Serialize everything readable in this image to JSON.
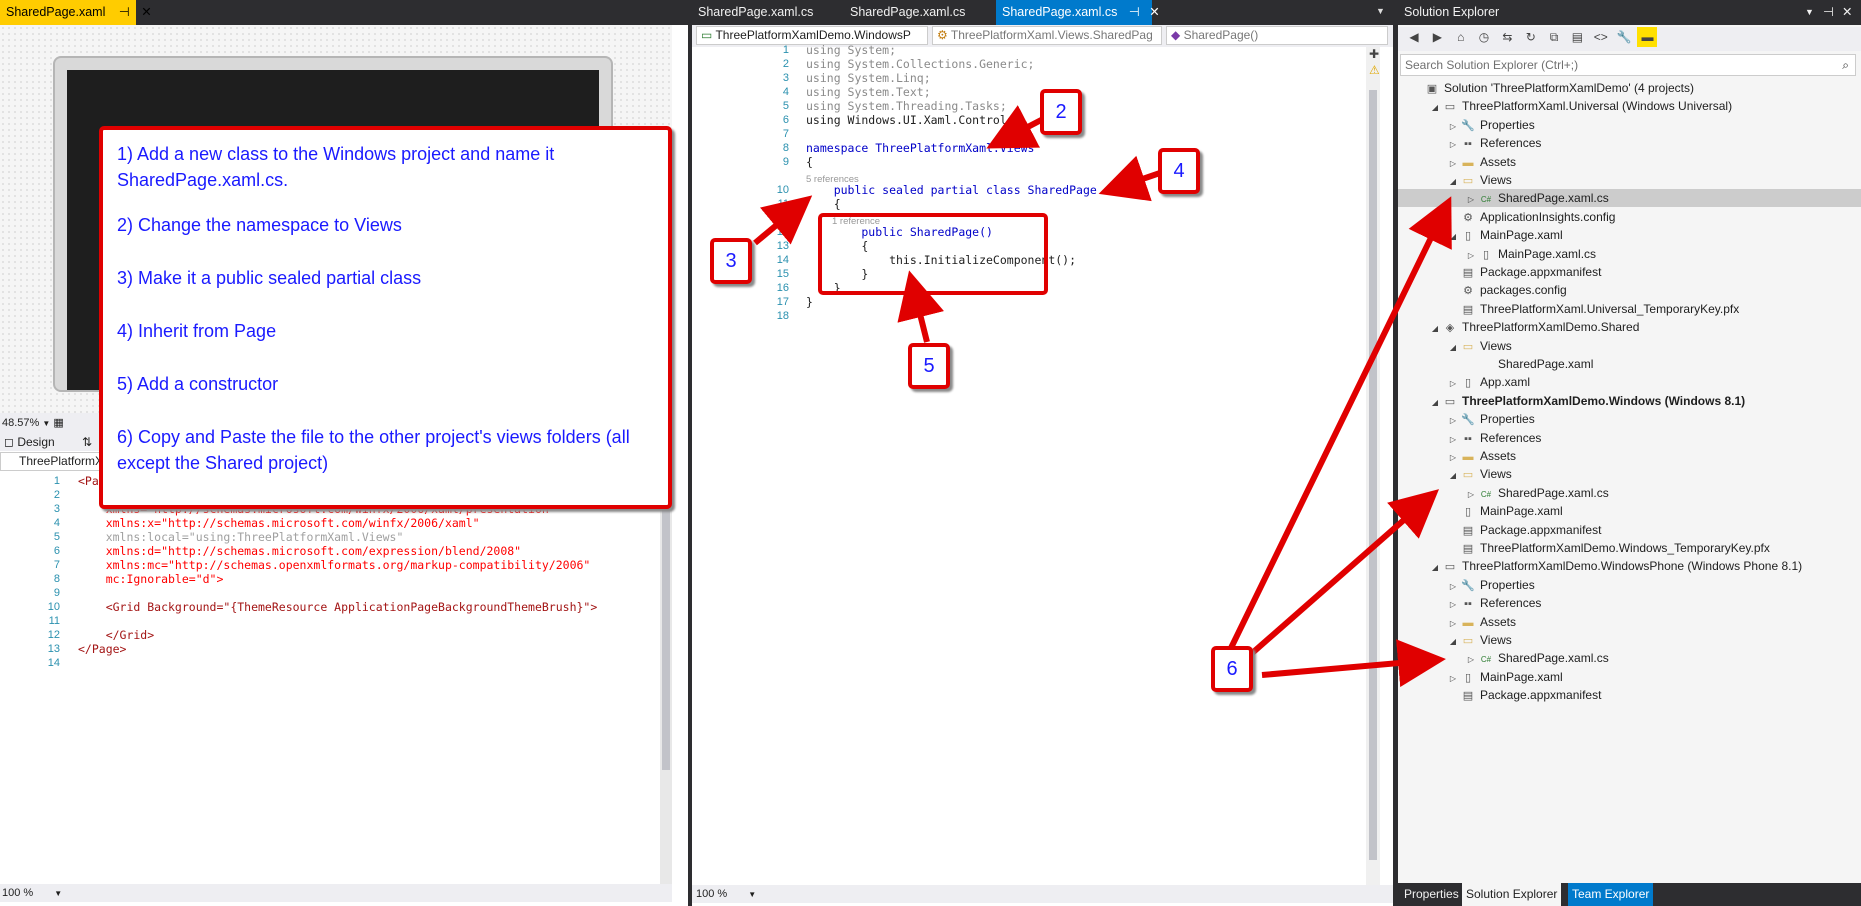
{
  "left": {
    "tab_title": "SharedPage.xaml",
    "zoom": "48.57%",
    "design_tab": "Design",
    "dropdown": "ThreePlatformX",
    "bottom_zoom": "100 %",
    "code": [
      {
        "n": "1",
        "t": "<Page"
      },
      {
        "n": "2",
        "t": ""
      },
      {
        "n": "3",
        "t": "    xmlns=\"http://schemas.microsoft.com/winfx/2006/xaml/presentation\""
      },
      {
        "n": "4",
        "t": "    xmlns:x=\"http://schemas.microsoft.com/winfx/2006/xaml\""
      },
      {
        "n": "5",
        "t": "    xmlns:local=\"using:ThreePlatformXaml.Views\""
      },
      {
        "n": "6",
        "t": "    xmlns:d=\"http://schemas.microsoft.com/expression/blend/2008\""
      },
      {
        "n": "7",
        "t": "    xmlns:mc=\"http://schemas.openxmlformats.org/markup-compatibility/2006\""
      },
      {
        "n": "8",
        "t": "    mc:Ignorable=\"d\">"
      },
      {
        "n": "9",
        "t": ""
      },
      {
        "n": "10",
        "t": "    <Grid Background=\"{ThemeResource ApplicationPageBackgroundThemeBrush}\">"
      },
      {
        "n": "11",
        "t": ""
      },
      {
        "n": "12",
        "t": "    </Grid>"
      },
      {
        "n": "13",
        "t": "</Page>"
      },
      {
        "n": "14",
        "t": ""
      }
    ]
  },
  "middle": {
    "tabs": [
      "SharedPage.xaml.cs",
      "SharedPage.xaml.cs",
      "SharedPage.xaml.cs"
    ],
    "nav_project": "ThreePlatformXamlDemo.WindowsP",
    "nav_class": "ThreePlatformXaml.Views.SharedPag",
    "nav_member": "SharedPage()",
    "bottom_zoom": "100 %",
    "code": [
      {
        "n": "1",
        "t": "using System;"
      },
      {
        "n": "2",
        "t": "using System.Collections.Generic;"
      },
      {
        "n": "3",
        "t": "using System.Linq;"
      },
      {
        "n": "4",
        "t": "using System.Text;"
      },
      {
        "n": "5",
        "t": "using System.Threading.Tasks;"
      },
      {
        "n": "6",
        "t": "using Windows.UI.Xaml.Controls;"
      },
      {
        "n": "7",
        "t": ""
      },
      {
        "n": "8",
        "t": "namespace ThreePlatformXaml.Views"
      },
      {
        "n": "9",
        "t": "{"
      },
      {
        "n": "10",
        "t": "    public sealed partial class SharedPage : Page"
      },
      {
        "n": "11",
        "t": "    {"
      },
      {
        "n": "12",
        "t": "        public SharedPage()"
      },
      {
        "n": "13",
        "t": "        {"
      },
      {
        "n": "14",
        "t": "            this.InitializeComponent();"
      },
      {
        "n": "15",
        "t": "        }"
      },
      {
        "n": "16",
        "t": "    }"
      },
      {
        "n": "17",
        "t": "}"
      },
      {
        "n": "18",
        "t": ""
      }
    ],
    "refs_class": "5 references",
    "refs_ctor": "1 reference"
  },
  "solution": {
    "title": "Solution Explorer",
    "search_placeholder": "Search Solution Explorer (Ctrl+;)",
    "items": [
      {
        "label": "Solution 'ThreePlatformXamlDemo' (4 projects)",
        "icon": "solution-icon",
        "glyph": "▣"
      },
      {
        "label": "ThreePlatformXaml.Universal (Windows Universal)",
        "icon": "project-icon",
        "glyph": "▭"
      },
      {
        "label": "Properties",
        "icon": "wrench-icon",
        "glyph": "🔧"
      },
      {
        "label": "References",
        "icon": "references-icon",
        "glyph": "▪▪"
      },
      {
        "label": "Assets",
        "icon": "folder-icon",
        "glyph": "▬"
      },
      {
        "label": "Views",
        "icon": "folder-open-icon",
        "glyph": "▭"
      },
      {
        "label": "SharedPage.xaml.cs",
        "icon": "csharp-file-icon",
        "glyph": "C#"
      },
      {
        "label": "ApplicationInsights.config",
        "icon": "config-icon",
        "glyph": "⚙"
      },
      {
        "label": "MainPage.xaml",
        "icon": "xaml-file-icon",
        "glyph": "▯"
      },
      {
        "label": "MainPage.xaml.cs",
        "icon": "cs-file-icon",
        "glyph": "▯"
      },
      {
        "label": "Package.appxmanifest",
        "icon": "manifest-icon",
        "glyph": "▤"
      },
      {
        "label": "packages.config",
        "icon": "config-icon",
        "glyph": "⚙"
      },
      {
        "label": "ThreePlatformXaml.Universal_TemporaryKey.pfx",
        "icon": "pfx-icon",
        "glyph": "▤"
      },
      {
        "label": "ThreePlatformXamlDemo.Shared",
        "icon": "shared-project-icon",
        "glyph": "◈"
      },
      {
        "label": "Views",
        "icon": "folder-open-icon",
        "glyph": "▭"
      },
      {
        "label": "SharedPage.xaml",
        "icon": "xaml-file-icon",
        "glyph": ""
      },
      {
        "label": "App.xaml",
        "icon": "xaml-file-icon",
        "glyph": "▯"
      },
      {
        "label": "ThreePlatformXamlDemo.Windows (Windows 8.1)",
        "icon": "project-icon",
        "glyph": "▭"
      },
      {
        "label": "Properties",
        "icon": "wrench-icon",
        "glyph": "🔧"
      },
      {
        "label": "References",
        "icon": "references-icon",
        "glyph": "▪▪"
      },
      {
        "label": "Assets",
        "icon": "folder-icon",
        "glyph": "▬"
      },
      {
        "label": "Views",
        "icon": "folder-open-icon",
        "glyph": "▭"
      },
      {
        "label": "SharedPage.xaml.cs",
        "icon": "csharp-file-icon",
        "glyph": "C#"
      },
      {
        "label": "MainPage.xaml",
        "icon": "xaml-file-icon",
        "glyph": "▯"
      },
      {
        "label": "Package.appxmanifest",
        "icon": "manifest-icon",
        "glyph": "▤"
      },
      {
        "label": "ThreePlatformXamlDemo.Windows_TemporaryKey.pfx",
        "icon": "pfx-icon",
        "glyph": "▤"
      },
      {
        "label": "ThreePlatformXamlDemo.WindowsPhone (Windows Phone 8.1)",
        "icon": "project-icon",
        "glyph": "▭"
      },
      {
        "label": "Properties",
        "icon": "wrench-icon",
        "glyph": "🔧"
      },
      {
        "label": "References",
        "icon": "references-icon",
        "glyph": "▪▪"
      },
      {
        "label": "Assets",
        "icon": "folder-icon",
        "glyph": "▬"
      },
      {
        "label": "Views",
        "icon": "folder-open-icon",
        "glyph": "▭"
      },
      {
        "label": "SharedPage.xaml.cs",
        "icon": "csharp-file-icon",
        "glyph": "C#"
      },
      {
        "label": "MainPage.xaml",
        "icon": "xaml-file-icon",
        "glyph": "▯"
      },
      {
        "label": "Package.appxmanifest",
        "icon": "manifest-icon",
        "glyph": "▤"
      }
    ],
    "bottom_tabs": [
      "Properties",
      "Solution Explorer",
      "Team Explorer"
    ]
  },
  "callout": {
    "steps": [
      "1) Add a new class to the Windows project and name it SharedPage.xaml.cs.",
      "2) Change the namespace to Views",
      "3) Make it a public sealed partial class",
      "4) Inherit from Page",
      "5) Add a constructor",
      "6) Copy and Paste the file to the other project's views folders (all except the Shared project)"
    ]
  },
  "markers": [
    "2",
    "4",
    "3",
    "5",
    "6"
  ],
  "colors": {
    "accent": "#e00000",
    "blue_text": "#1a1aff",
    "vs_tab": "#007acc"
  }
}
